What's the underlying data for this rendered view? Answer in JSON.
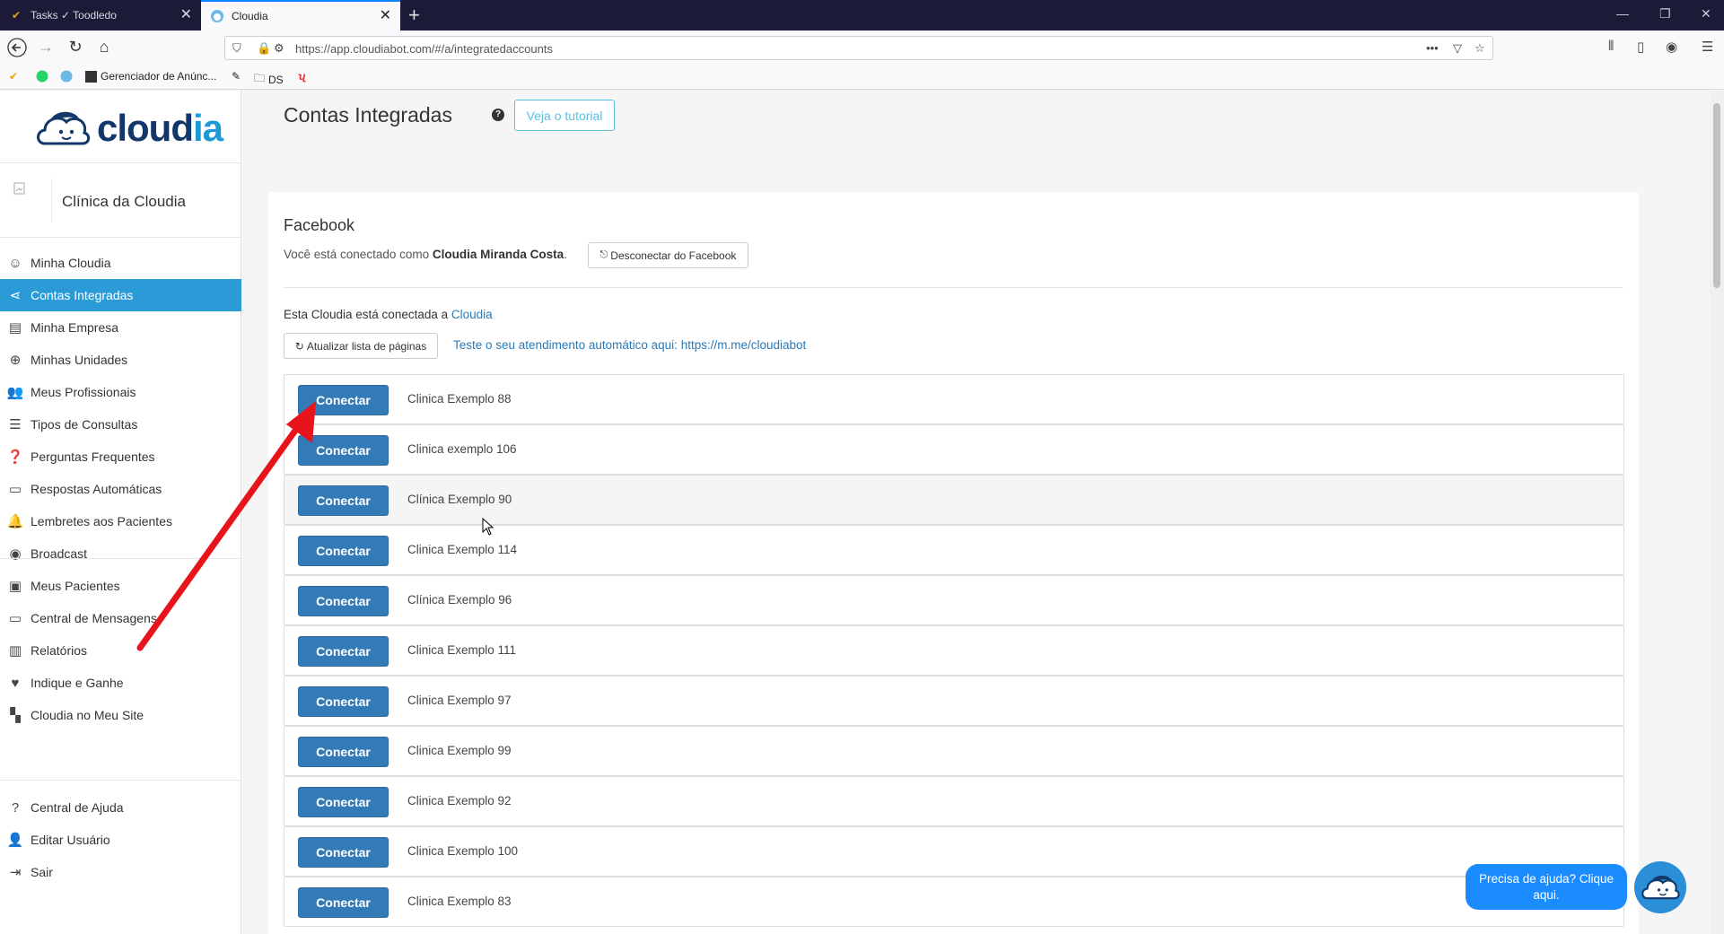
{
  "browser": {
    "tabs": [
      {
        "title": "Tasks ✓ Toodledo",
        "active": false
      },
      {
        "title": "Cloudia",
        "active": true
      }
    ],
    "url": "https://app.cloudiabot.com/#/a/integratedaccounts",
    "bookmarks": [
      "Gerenciador de Anúnc...",
      "DS"
    ]
  },
  "sidebar": {
    "logo": {
      "dark": "cloud",
      "accent": "ia"
    },
    "profile_name": "Clínica da Cloudia",
    "groups": [
      [
        {
          "label": "Minha Cloudia",
          "icon": "smile-icon",
          "glyph": "☺"
        },
        {
          "label": "Contas Integradas",
          "icon": "share-icon",
          "glyph": "⋖",
          "active": true
        },
        {
          "label": "Minha Empresa",
          "icon": "building-icon",
          "glyph": "▤"
        },
        {
          "label": "Minhas Unidades",
          "icon": "plus-circle-icon",
          "glyph": "⊕"
        },
        {
          "label": "Meus Profissionais",
          "icon": "people-icon",
          "glyph": "👥"
        },
        {
          "label": "Tipos de Consultas",
          "icon": "list-icon",
          "glyph": "☰"
        },
        {
          "label": "Perguntas Frequentes",
          "icon": "question-icon",
          "glyph": "❓"
        },
        {
          "label": "Respostas Automáticas",
          "icon": "message-icon",
          "glyph": "▭"
        },
        {
          "label": "Lembretes aos Pacientes",
          "icon": "bell-icon",
          "glyph": "🔔"
        },
        {
          "label": "Broadcast",
          "icon": "broadcast-icon",
          "glyph": "◉"
        }
      ],
      [
        {
          "label": "Meus Pacientes",
          "icon": "contact-card-icon",
          "glyph": "▣"
        },
        {
          "label": "Central de Mensagens",
          "icon": "chat-icon",
          "glyph": "▭"
        },
        {
          "label": "Relatórios",
          "icon": "bar-chart-icon",
          "glyph": "▥"
        },
        {
          "label": "Indique e Ganhe",
          "icon": "heart-icon",
          "glyph": "♥"
        },
        {
          "label": "Cloudia no Meu Site",
          "icon": "widgets-icon",
          "glyph": "▚"
        }
      ],
      [
        {
          "label": "Central de Ajuda",
          "icon": "help-circle-icon",
          "glyph": "?"
        },
        {
          "label": "Editar Usuário",
          "icon": "user-icon",
          "glyph": "👤"
        },
        {
          "label": "Sair",
          "icon": "logout-icon",
          "glyph": "⇥"
        }
      ]
    ]
  },
  "main": {
    "title": "Contas Integradas",
    "help_glyph": "?",
    "tutorial_label": "Veja o tutorial",
    "facebook": {
      "heading": "Facebook",
      "connected_prefix": "Você está conectado como",
      "connected_user": "Cloudia Miranda Costa",
      "connected_suffix": ".",
      "disconnect_label": "Desconectar do Facebook",
      "linked_prefix": "Esta Cloudia está conectada a",
      "linked_name": "Cloudia",
      "refresh_label": "Atualizar lista de páginas",
      "test_prefix": "Teste o seu atendimento automático aqui:",
      "test_link": "https://m.me/cloudiabot"
    },
    "connect_label": "Conectar",
    "pages": [
      "Clinica Exemplo 88",
      "Clinica exemplo 106",
      "Clínica Exemplo 90",
      "Clinica Exemplo 114",
      "Clínica Exemplo 96",
      "Clinica Exemplo 111",
      "Clinica Exemplo 97",
      "Clinica Exemplo 99",
      "Clinica Exemplo 92",
      "Clinica Exemplo 100",
      "Clinica Exemplo 83"
    ]
  },
  "help_chat": {
    "text": "Precisa de ajuda? Clique aqui."
  },
  "colors": {
    "accent": "#2b9bd7",
    "primary_button": "#337ab7",
    "annotation_arrow": "#e8141c"
  }
}
